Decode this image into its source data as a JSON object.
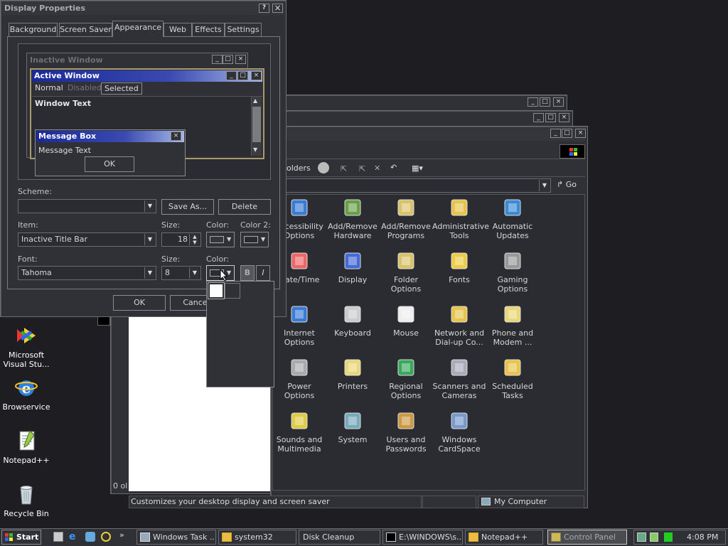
{
  "desktop": {
    "icons": [
      {
        "label": "Microsoft Visual Stu...",
        "icon": "visual-studio-icon"
      },
      {
        "label": "Browservice",
        "icon": "ie-icon"
      },
      {
        "label": "Notepad++",
        "icon": "notepad-icon"
      },
      {
        "label": "Recycle Bin",
        "icon": "recycle-bin-icon"
      }
    ]
  },
  "display_props": {
    "title": "Display Properties",
    "help": "?",
    "close": "×",
    "tabs": [
      "Background",
      "Screen Saver",
      "Appearance",
      "Web",
      "Effects",
      "Settings"
    ],
    "preview": {
      "inactive_title": "Inactive Window",
      "active_title": "Active Window",
      "menu": [
        "Normal",
        "Disabled",
        "Selected"
      ],
      "window_text": "Window Text",
      "msg_title": "Message Box",
      "msg_text": "Message Text",
      "msg_ok": "OK"
    },
    "scheme_label": "Scheme:",
    "scheme_value": "",
    "save_as": "Save As...",
    "delete": "Delete",
    "item_label": "Item:",
    "item_value": "Inactive Title Bar",
    "size_label": "Size:",
    "size_value": "18",
    "color_label": "Color:",
    "color2_label": "Color 2:",
    "font_label": "Font:",
    "font_value": "Tahoma",
    "fsize_label": "Size:",
    "fsize_value": "8",
    "fcolor_label": "Color:",
    "bold": "B",
    "italic": "I",
    "ok": "OK",
    "cancel": "Cancel"
  },
  "control_panel": {
    "address_go": "Go",
    "folders": "olders",
    "items": [
      {
        "label": "Accessibility Options",
        "icon": "accessibility-icon"
      },
      {
        "label": "Add/Remove Hardware",
        "icon": "hardware-icon"
      },
      {
        "label": "Add/Remove Programs",
        "icon": "programs-icon"
      },
      {
        "label": "Administrative Tools",
        "icon": "admin-tools-icon"
      },
      {
        "label": "Automatic Updates",
        "icon": "updates-icon"
      },
      {
        "label": "Date/Time",
        "icon": "datetime-icon"
      },
      {
        "label": "Display",
        "icon": "display-icon"
      },
      {
        "label": "Folder Options",
        "icon": "folder-options-icon"
      },
      {
        "label": "Fonts",
        "icon": "fonts-icon"
      },
      {
        "label": "Gaming Options",
        "icon": "gaming-icon"
      },
      {
        "label": "Internet Options",
        "icon": "internet-icon"
      },
      {
        "label": "Keyboard",
        "icon": "keyboard-icon"
      },
      {
        "label": "Mouse",
        "icon": "mouse-icon"
      },
      {
        "label": "Network and Dial-up Co...",
        "icon": "network-icon"
      },
      {
        "label": "Phone and Modem ...",
        "icon": "phone-icon"
      },
      {
        "label": "Power Options",
        "icon": "power-icon"
      },
      {
        "label": "Printers",
        "icon": "printers-icon"
      },
      {
        "label": "Regional Options",
        "icon": "regional-icon"
      },
      {
        "label": "Scanners and Cameras",
        "icon": "scanner-icon"
      },
      {
        "label": "Scheduled Tasks",
        "icon": "tasks-icon"
      },
      {
        "label": "Sounds and Multimedia",
        "icon": "sounds-icon"
      },
      {
        "label": "System",
        "icon": "system-icon"
      },
      {
        "label": "Users and Passwords",
        "icon": "users-icon"
      },
      {
        "label": "Windows CardSpace",
        "icon": "cardspace-icon"
      }
    ],
    "status_text": "Customizes your desktop display and screen saver",
    "status_zone": "My Computer"
  },
  "bg_window": {
    "status": "0 ol"
  },
  "taskbar": {
    "start": "Start",
    "buttons": [
      "Windows Task ...",
      "system32",
      "Disk Cleanup",
      "E:\\WINDOWS\\s...",
      "Notepad++",
      "Control Panel"
    ],
    "clock": "4:08 PM"
  }
}
